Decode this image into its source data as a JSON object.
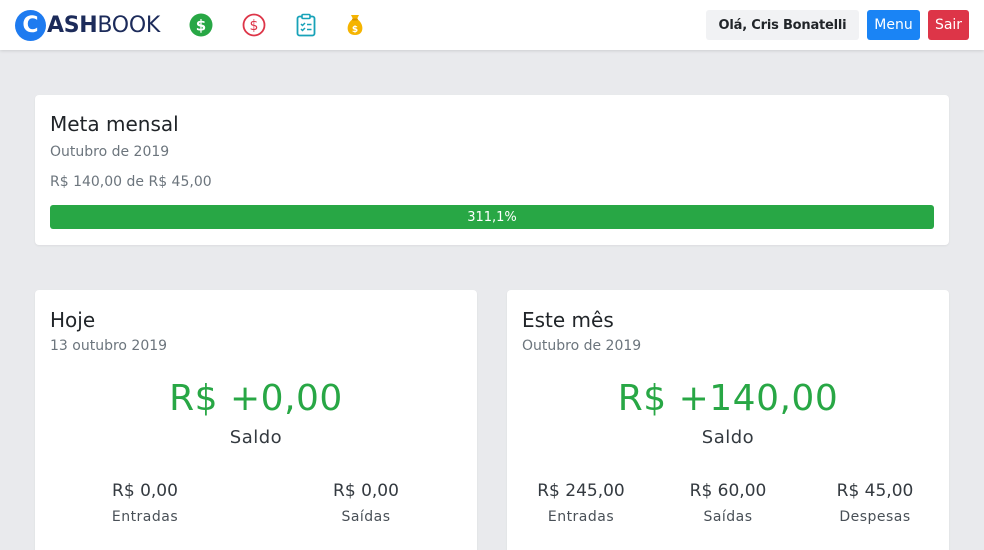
{
  "header": {
    "logo_letter": "C",
    "logo_bold": "ASH",
    "logo_rest": "BOOK",
    "greeting": "Olá, Cris Bonatelli",
    "menu_label": "Menu",
    "logout_label": "Sair",
    "icons": [
      "dollar-circle-icon",
      "dollar-outline-icon",
      "clipboard-list-icon",
      "money-bag-icon"
    ]
  },
  "colors": {
    "brand_blue": "#1e7bf0",
    "green": "#28a745",
    "red": "#dd3548",
    "gold": "#f5b400",
    "teal": "#17a2b8"
  },
  "monthly_goal": {
    "title": "Meta mensal",
    "period": "Outubro de 2019",
    "progress_text": "R$ 140,00 de R$ 45,00",
    "percent_label": "311,1%",
    "percent_value": 311.1
  },
  "today": {
    "title": "Hoje",
    "date": "13 outubro 2019",
    "balance": "R$ +0,00",
    "balance_label": "Saldo",
    "stats": [
      {
        "value": "R$ 0,00",
        "label": "Entradas"
      },
      {
        "value": "R$ 0,00",
        "label": "Saídas"
      }
    ]
  },
  "month": {
    "title": "Este mês",
    "date": "Outubro de 2019",
    "balance": "R$ +140,00",
    "balance_label": "Saldo",
    "stats": [
      {
        "value": "R$ 245,00",
        "label": "Entradas"
      },
      {
        "value": "R$ 60,00",
        "label": "Saídas"
      },
      {
        "value": "R$ 45,00",
        "label": "Despesas"
      }
    ]
  }
}
